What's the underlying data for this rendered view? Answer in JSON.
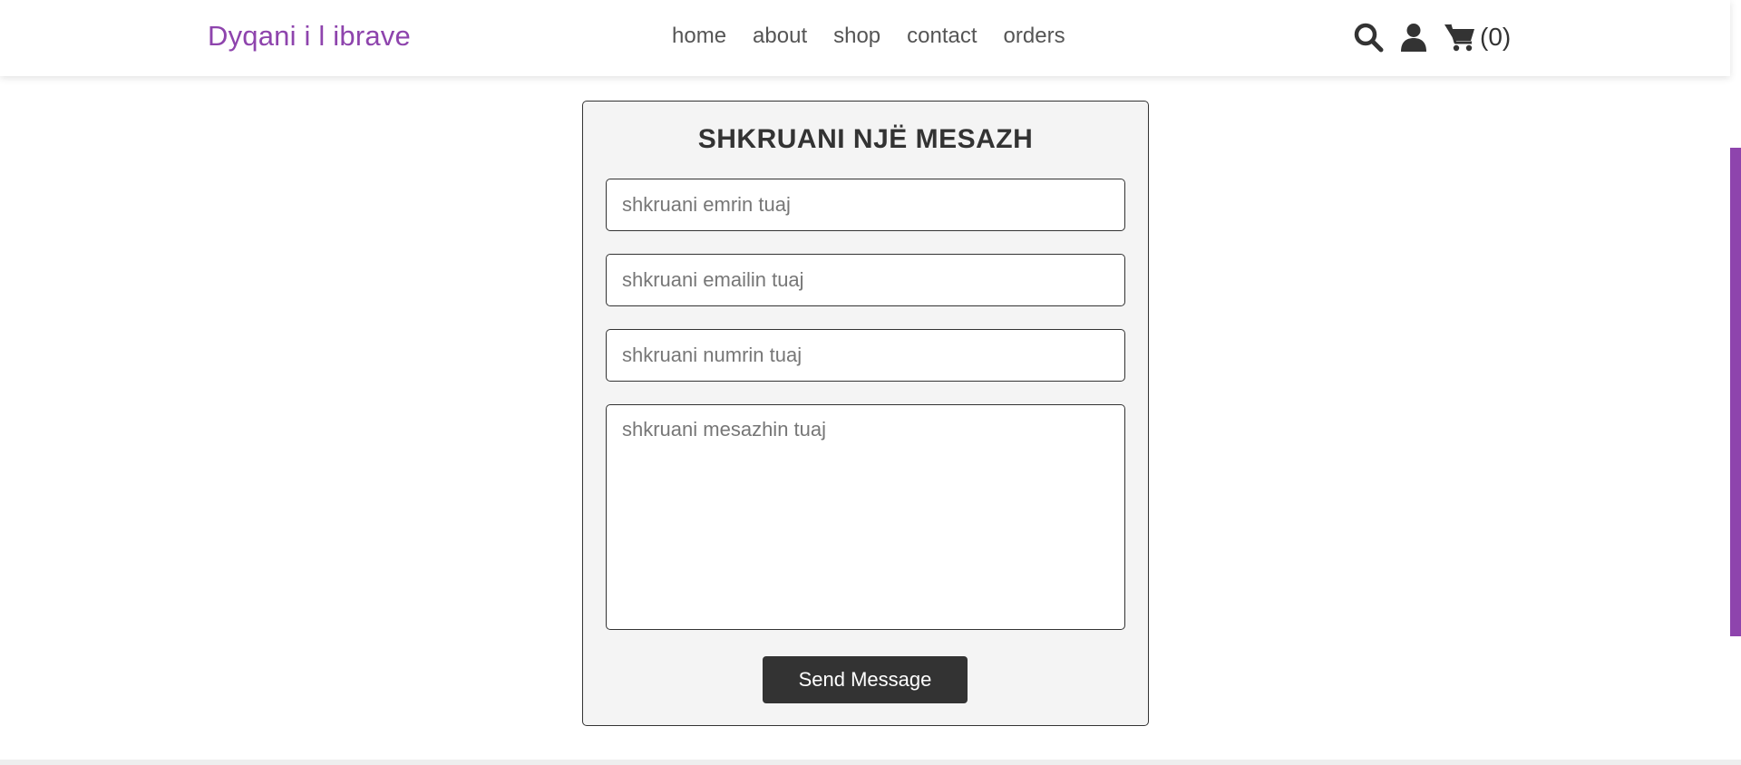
{
  "header": {
    "logo": "Dyqani i l ibrave",
    "nav": [
      "home",
      "about",
      "shop",
      "contact",
      "orders"
    ],
    "icons": {
      "search": "search-icon",
      "user": "user-icon",
      "cart": "cart-icon"
    },
    "cart_count": "(0)"
  },
  "form": {
    "title": "SHKRUANI NJË MESAZH",
    "name_placeholder": "shkruani emrin tuaj",
    "email_placeholder": "shkruani emailin tuaj",
    "number_placeholder": "shkruani numrin tuaj",
    "message_placeholder": "shkruani mesazhin tuaj",
    "send_label": "Send Message"
  },
  "colors": {
    "brand": "#8e44ad",
    "dark": "#333333",
    "form_bg": "#f4f4f4"
  }
}
